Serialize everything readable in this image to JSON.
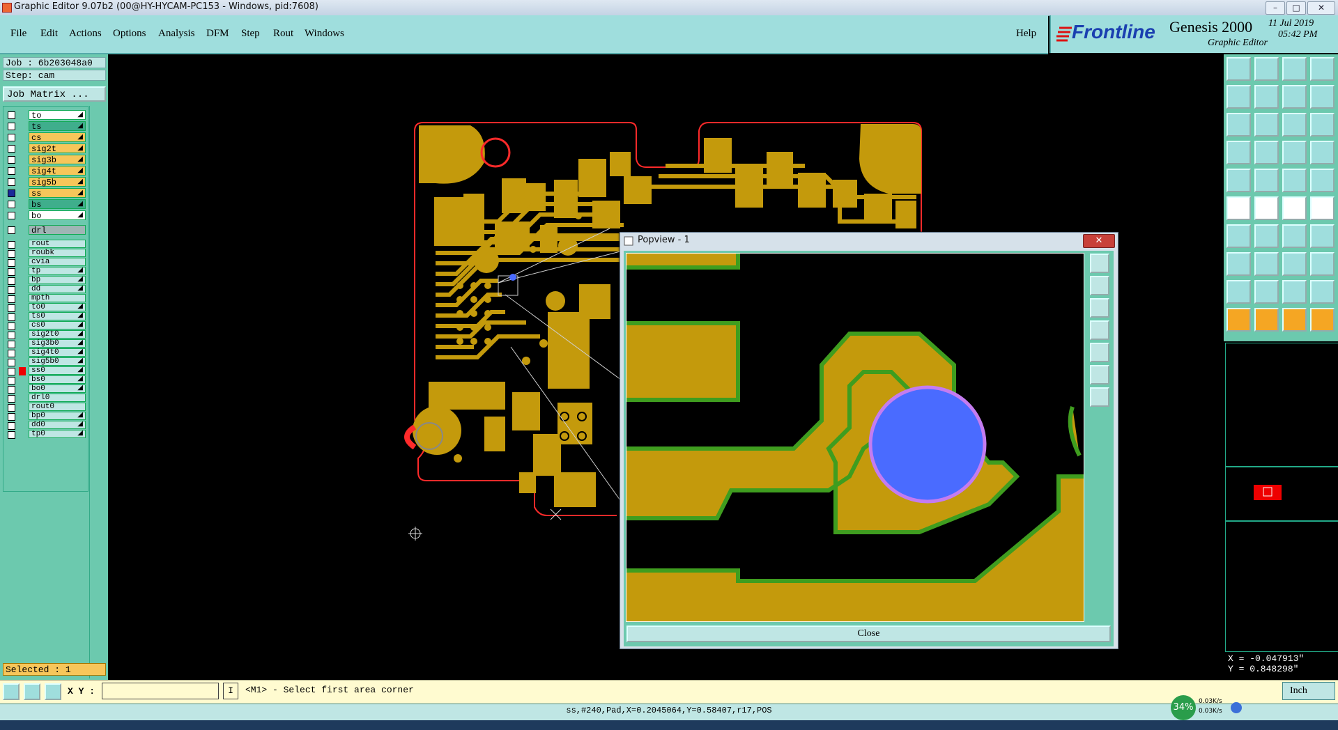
{
  "window": {
    "title": "Graphic Editor 9.07b2 (00@HY-HYCAM-PC153 - Windows, pid:7608)",
    "min": "–",
    "max": "□",
    "close": "✕"
  },
  "menu": [
    "File",
    "Edit",
    "Actions",
    "Options",
    "Analysis",
    "DFM",
    "Step",
    "Rout",
    "Windows"
  ],
  "help": "Help",
  "brand": {
    "logo": "Frontline",
    "product": "Genesis 2000",
    "subtitle": "Graphic Editor",
    "date": "11 Jul 2019",
    "time": "05:42 PM"
  },
  "job": {
    "job": "Job : 6b203048a0",
    "step": "Step: cam",
    "matrix_button": "Job Matrix ..."
  },
  "layers_top": [
    {
      "name": "to",
      "color": "#ffffff",
      "mark": "◢"
    },
    {
      "name": "ts",
      "color": "#3fae8c",
      "mark": "◢"
    },
    {
      "name": "cs",
      "color": "#f7c65a",
      "mark": "◢"
    },
    {
      "name": "sig2t",
      "color": "#f7c65a",
      "mark": "◢"
    },
    {
      "name": "sig3b",
      "color": "#f7c65a",
      "mark": "◢"
    },
    {
      "name": "sig4t",
      "color": "#f7c65a",
      "mark": "◢"
    },
    {
      "name": "sig5b",
      "color": "#f7c65a",
      "mark": "◢"
    },
    {
      "name": "ss",
      "color": "#f7c65a",
      "mark": "◢"
    },
    {
      "name": "bs",
      "color": "#3fae8c",
      "mark": "◢"
    },
    {
      "name": "bo",
      "color": "#ffffff",
      "mark": "◢"
    }
  ],
  "layer_drl": {
    "name": "drl",
    "color": "#9fb5b5"
  },
  "layers_bottom": [
    {
      "name": "rout",
      "color": "#bfe6e4",
      "mark": ""
    },
    {
      "name": "roubk",
      "color": "#bfe6e4",
      "mark": ""
    },
    {
      "name": "cvia",
      "color": "#bfe6e4",
      "mark": ""
    },
    {
      "name": "tp",
      "color": "#bfe6e4",
      "mark": "◢"
    },
    {
      "name": "bp",
      "color": "#bfe6e4",
      "mark": "◢"
    },
    {
      "name": "dd",
      "color": "#bfe6e4",
      "mark": "◢"
    },
    {
      "name": "mpth",
      "color": "#bfe6e4",
      "mark": ""
    },
    {
      "name": "to0",
      "color": "#bfe6e4",
      "mark": "◢"
    },
    {
      "name": "ts0",
      "color": "#bfe6e4",
      "mark": "◢"
    },
    {
      "name": "cs0",
      "color": "#bfe6e4",
      "mark": "◢"
    },
    {
      "name": "sig2t0",
      "color": "#bfe6e4",
      "mark": "◢"
    },
    {
      "name": "sig3b0",
      "color": "#bfe6e4",
      "mark": "◢"
    },
    {
      "name": "sig4t0",
      "color": "#bfe6e4",
      "mark": "◢"
    },
    {
      "name": "sig5b0",
      "color": "#bfe6e4",
      "mark": "◢"
    },
    {
      "name": "ss0",
      "color": "#bfe6e4",
      "mark": "◢"
    },
    {
      "name": "bs0",
      "color": "#bfe6e4",
      "mark": "◢"
    },
    {
      "name": "bo0",
      "color": "#bfe6e4",
      "mark": "◢"
    },
    {
      "name": "drl0",
      "color": "#bfe6e4",
      "mark": ""
    },
    {
      "name": "rout0",
      "color": "#bfe6e4",
      "mark": ""
    },
    {
      "name": "bp0",
      "color": "#bfe6e4",
      "mark": "◢"
    },
    {
      "name": "dd0",
      "color": "#bfe6e4",
      "mark": "◢"
    },
    {
      "name": "tp0",
      "color": "#bfe6e4",
      "mark": "◢"
    }
  ],
  "selected": "Selected : 1",
  "coords": {
    "x": "X = -0.047913\"",
    "y": "Y =  0.848298\""
  },
  "command": {
    "xy_label": "X Y :",
    "xy_value": "",
    "cursor_glyph": "I",
    "prompt": "<M1> - Select first area corner"
  },
  "units": "Inch",
  "status": "ss,#240,Pad,X=0.2045064,Y=0.58407,r17,POS",
  "popview": {
    "title": "Popview - 1",
    "close_label": "Close"
  },
  "speed": {
    "percent": "34%",
    "up": "0.03K/s",
    "down": "0.03K/s"
  },
  "colors": {
    "copper": "#c49a0c",
    "outline": "#ff1a1a",
    "pad_blue": "#4a6bff",
    "panel": "#6cc9ae",
    "menu": "#9fdedd"
  }
}
